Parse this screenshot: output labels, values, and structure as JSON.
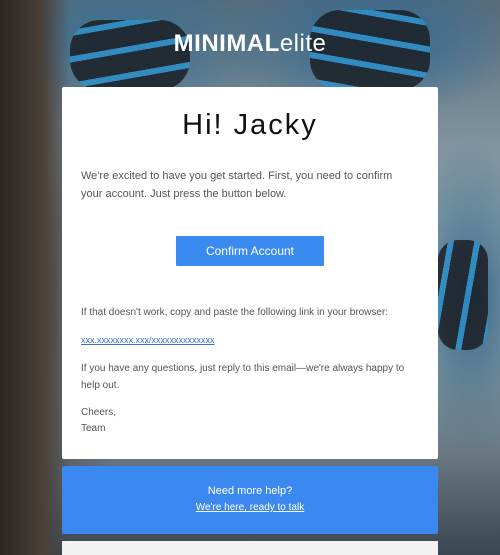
{
  "brand": {
    "strong": "MINIMAL",
    "light": "elite"
  },
  "email": {
    "greeting": "Hi! Jacky",
    "intro": "We're excited to have you get started. First, you need to confirm your account. Just press the button below.",
    "confirm_button": "Confirm Account",
    "fallback_text": "If that doesn't work, copy and paste the following link in your browser:",
    "fallback_link": "xxx.xxxxxxxx.xxx/xxxxxxxxxxxxxx",
    "questions_text": "If you have any questions, just reply to this email—we're always happy to help out.",
    "signoff_line1": "Cheers,",
    "signoff_line2": "Team"
  },
  "help": {
    "title": "Need more help?",
    "link": "We're here, ready to talk"
  },
  "colors": {
    "accent": "#3a8af0",
    "card": "#ffffff",
    "link": "#3a6fd8"
  }
}
